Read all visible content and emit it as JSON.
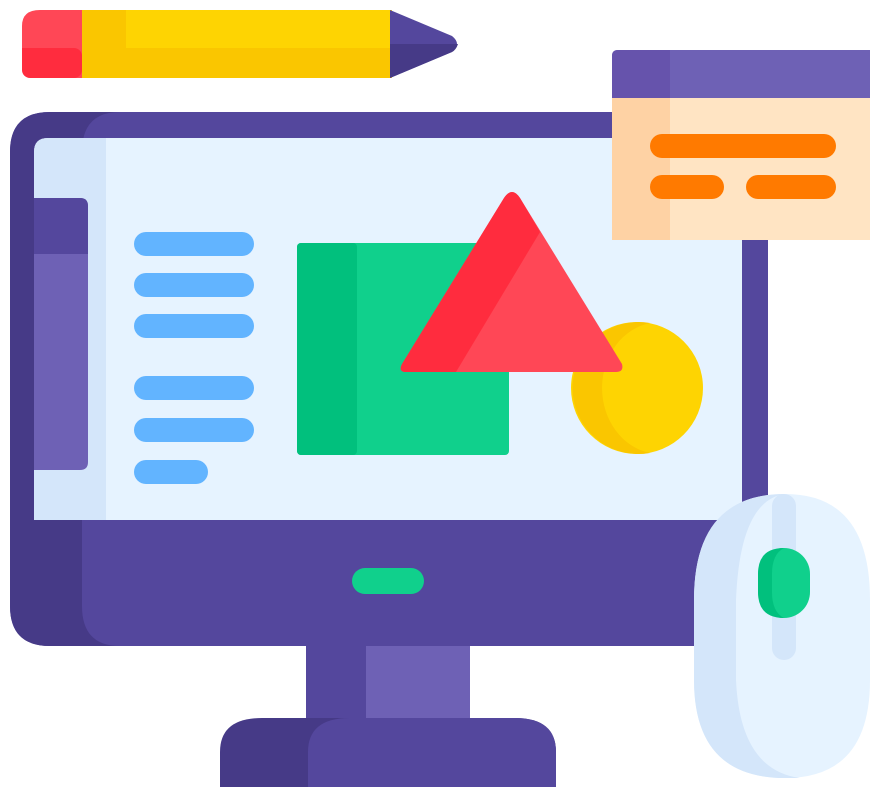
{
  "illustration": {
    "subject": "graphic-design-computer-icon",
    "icons": [
      "pencil-icon",
      "monitor-icon",
      "popup-window-icon",
      "mouse-icon",
      "square-shape",
      "triangle-shape",
      "circle-shape"
    ],
    "colors": {
      "monitor_dark": "#463A87",
      "monitor_main": "#54479D",
      "monitor_light": "#6E61B5",
      "screen_bg": "#E6F3FF",
      "screen_edge": "#D4E6FA",
      "text_lines": "#62B4FF",
      "square_main": "#10D08C",
      "square_dark": "#01C07D",
      "triangle_main": "#FF4756",
      "triangle_dark": "#FF2C3E",
      "circle_main": "#FED402",
      "circle_dark": "#FAC600",
      "popup_header": "#6E61B5",
      "popup_header_dark": "#6653AC",
      "popup_body": "#FFE4C3",
      "popup_body_dark": "#FED2A4",
      "popup_lines": "#FF7A00",
      "mouse_body": "#E6F3FF",
      "mouse_edge": "#D4E6FA",
      "mouse_wheel": "#10D08C",
      "pencil_eraser": "#FF4756",
      "pencil_body": "#FED402",
      "pencil_tip": "#54479D"
    }
  }
}
